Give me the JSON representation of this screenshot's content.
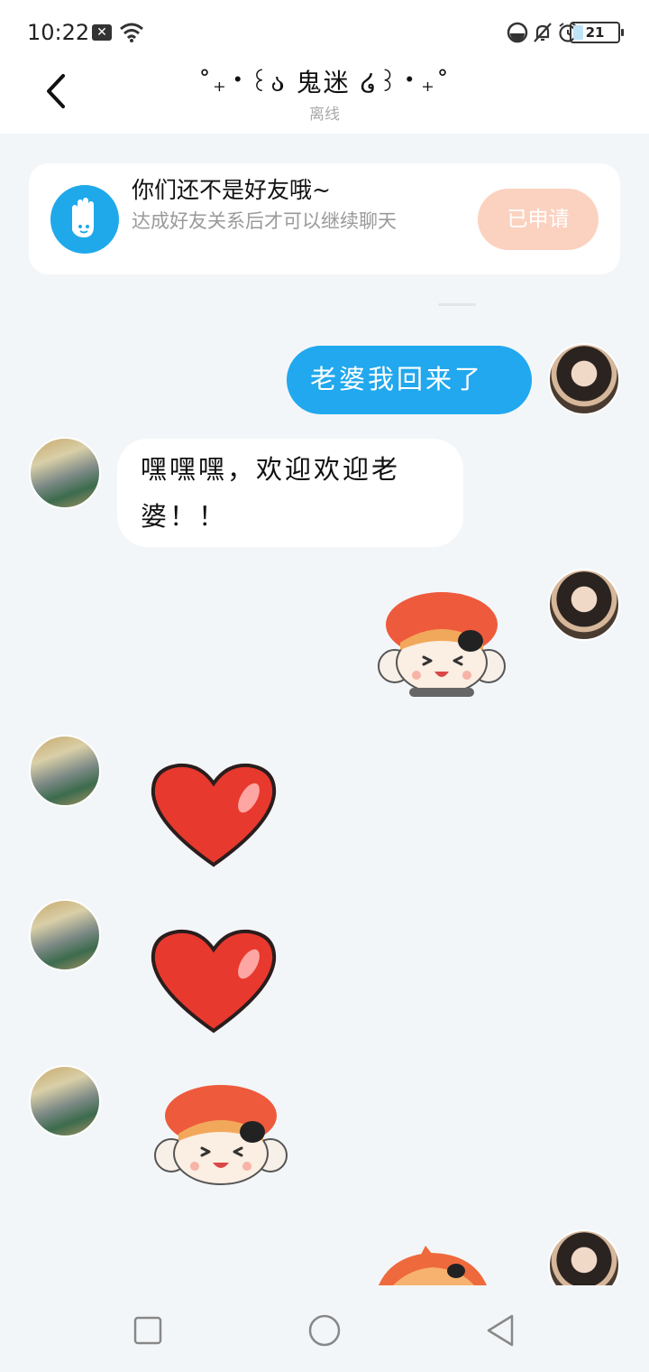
{
  "status_bar": {
    "time": "10:22",
    "battery": "21",
    "battery_level": 0.21
  },
  "header": {
    "title": "˚₊‧꒰ა 鬼迷 ໒꒱‧₊˚",
    "subtitle": "离线"
  },
  "notice": {
    "title": "你们还不是好友哦~",
    "description": "达成好友关系后才可以继续聊天",
    "button_label": "已申请"
  },
  "messages": [
    {
      "side": "out",
      "type": "text",
      "text": "老婆我回来了"
    },
    {
      "side": "in",
      "type": "text",
      "text": "嘿嘿嘿，欢迎欢迎老婆！！"
    },
    {
      "side": "out",
      "type": "sticker",
      "sticker": "orange-hair-girl-sticker"
    },
    {
      "side": "in",
      "type": "sticker",
      "sticker": "red-heart-sticker"
    },
    {
      "side": "in",
      "type": "sticker",
      "sticker": "red-heart-sticker"
    },
    {
      "side": "in",
      "type": "sticker",
      "sticker": "orange-hair-girl-sticker"
    },
    {
      "side": "out",
      "type": "sticker",
      "sticker": "orange-hair-girl-sticker"
    }
  ],
  "colors": {
    "accent_blue": "#21a8ee",
    "applied_button": "#fbd2c0",
    "background": "#f3f6f8"
  }
}
